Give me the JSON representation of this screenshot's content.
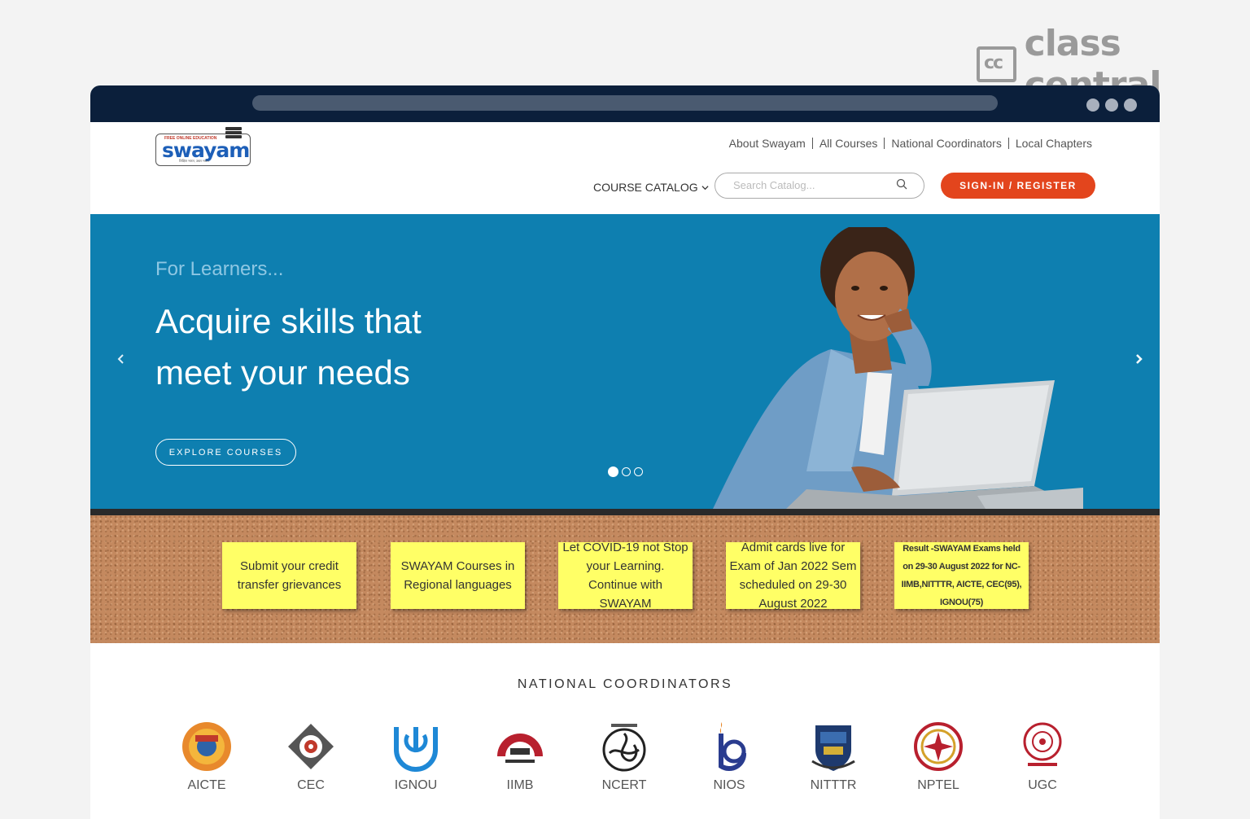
{
  "brand": {
    "text": "class central",
    "box": "cc"
  },
  "site": {
    "logo": {
      "word": "swayam",
      "tagline": "FREE ONLINE EDUCATION",
      "sub": "शिक्षित भारत, उन्नत भारत"
    },
    "top_links": [
      "About Swayam",
      "All Courses",
      "National Coordinators",
      "Local Chapters"
    ],
    "catalog_label": "COURSE CATALOG",
    "search_placeholder": "Search Catalog...",
    "signin_label": "SIGN-IN / REGISTER"
  },
  "hero": {
    "eyebrow": "For Learners...",
    "title": "Acquire skills that meet your needs",
    "cta": "EXPLORE COURSES",
    "slides": 3,
    "active_slide": 1
  },
  "notes": [
    "Submit your credit transfer grievances",
    "SWAYAM Courses in Regional languages",
    "Let COVID-19 not Stop your Learning. Continue with SWAYAM",
    "Admit cards live for Exam of Jan 2022 Sem scheduled on 29-30 August 2022",
    "Result -SWAYAM Exams held on 29-30 August 2022 for NC-IIMB,NITTTR, AICTE, CEC(95), IGNOU(75)"
  ],
  "coordinators": {
    "heading": "NATIONAL COORDINATORS",
    "items": [
      "AICTE",
      "CEC",
      "IGNOU",
      "IIMB",
      "NCERT",
      "NIOS",
      "NITTTR",
      "NPTEL",
      "UGC"
    ]
  },
  "colors": {
    "header_bar": "#0b1f3b",
    "hero_bg": "#0e7fb0",
    "signin": "#e3451d",
    "note": "#ffff66",
    "cork": "#c4895f"
  }
}
